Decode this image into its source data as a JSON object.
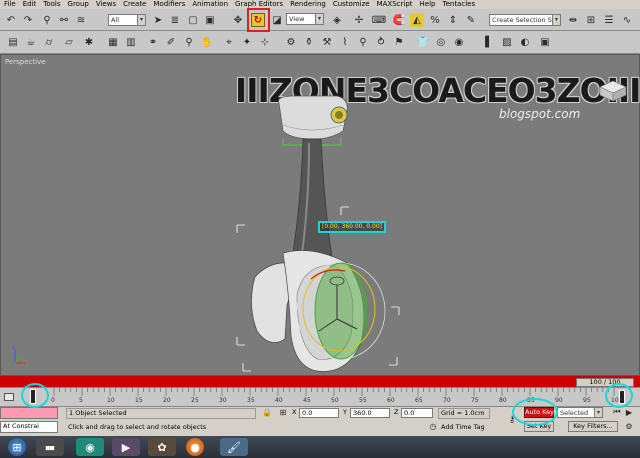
{
  "menu": [
    "File",
    "Edit",
    "Tools",
    "Group",
    "Views",
    "Create",
    "Modifiers",
    "Animation",
    "Graph Editors",
    "Rendering",
    "Customize",
    "MAXScript",
    "Help",
    "Tentacles"
  ],
  "toolbar": {
    "filter_select": "All",
    "view_select": "View",
    "selection_set": "Create Selection Se"
  },
  "viewport": {
    "label": "Perspective",
    "brand_text": "IIIZONE3COACEO3ZOIII",
    "brand_sub": "blogspot.com",
    "coord_readout": "[0.00, 360.00, 0.00]"
  },
  "timeline": {
    "frame_counter": "100 / 100",
    "ticks": [
      "0",
      "5",
      "10",
      "15",
      "20",
      "25",
      "30",
      "35",
      "40",
      "45",
      "50",
      "55",
      "60",
      "65",
      "70",
      "75",
      "80",
      "85",
      "90",
      "95",
      "100"
    ]
  },
  "status": {
    "mini_listener": "At Constrai",
    "selection_info": "1 Object Selected",
    "prompt": "Click and drag to select and rotate objects",
    "x_label": "X",
    "x_value": "0.0",
    "y_label": "Y",
    "y_value": "360.0",
    "z_label": "Z",
    "z_value": "0.0",
    "grid": "Grid = 1.0cm",
    "add_time_tag": "Add Time Tag",
    "auto_key": "Auto Key",
    "set_key": "Set Key",
    "key_filters": "Key Filters...",
    "selected_select": "Selected"
  }
}
